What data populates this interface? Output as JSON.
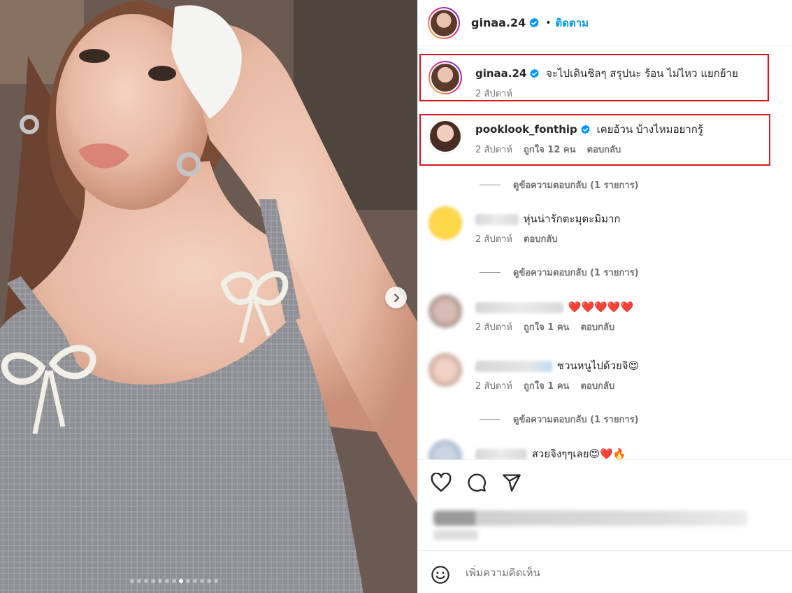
{
  "photo": {
    "carousel_dots_total": 13,
    "carousel_dots_active_index": 7,
    "next_icon": "chevron-right-icon"
  },
  "header": {
    "username": "ginaa.24",
    "verified_icon": "verified-badge-icon",
    "separator": "•",
    "follow_label": "ติดตาม"
  },
  "comments": [
    {
      "username": "ginaa.24",
      "verified": true,
      "text": "จะไปเดินชิลๆ สรุปนะ ร้อน ไม่ไหว แยกย้าย",
      "time": "2 สัปดาห์",
      "likes": "",
      "reply": ""
    },
    {
      "username": "pooklook_fonthip",
      "verified": true,
      "text": "เคยอ้วน บ้างไหมอยากรู้",
      "time": "2 สัปดาห์",
      "likes": "ถูกใจ 12 คน",
      "reply": "ตอบกลับ"
    },
    {
      "username": "",
      "verified": false,
      "text": "หุ่นน่ารักตะมุตะมิมาก",
      "time": "2 สัปดาห์",
      "likes": "",
      "reply": "ตอบกลับ"
    },
    {
      "username": "",
      "verified": false,
      "text": "❤️❤️❤️❤️❤️",
      "time": "2 สัปดาห์",
      "likes": "ถูกใจ 1 คน",
      "reply": "ตอบกลับ"
    },
    {
      "username": "",
      "verified": false,
      "text": "ชวนหนูไปด้วยจิ😍",
      "time": "2 สัปดาห์",
      "likes": "ถูกใจ 1 คน",
      "reply": "ตอบกลับ"
    },
    {
      "username": "",
      "verified": false,
      "text": "สวยจิงๆๆเลย😍❤️🔥",
      "time": "",
      "likes": "",
      "reply": ""
    }
  ],
  "view_replies_label": "ดูข้อความตอบกลับ (1 รายการ)",
  "actions": {
    "like_icon": "heart-icon",
    "comment_icon": "comment-icon",
    "share_icon": "send-icon"
  },
  "add_comment": {
    "emoji_icon": "smiley-icon",
    "placeholder": "เพิ่มความคิดเห็น"
  },
  "colors": {
    "highlight": "#e0141e",
    "link_blue": "#0095f6",
    "verified_blue": "#0095f6",
    "meta_gray": "#737373"
  }
}
